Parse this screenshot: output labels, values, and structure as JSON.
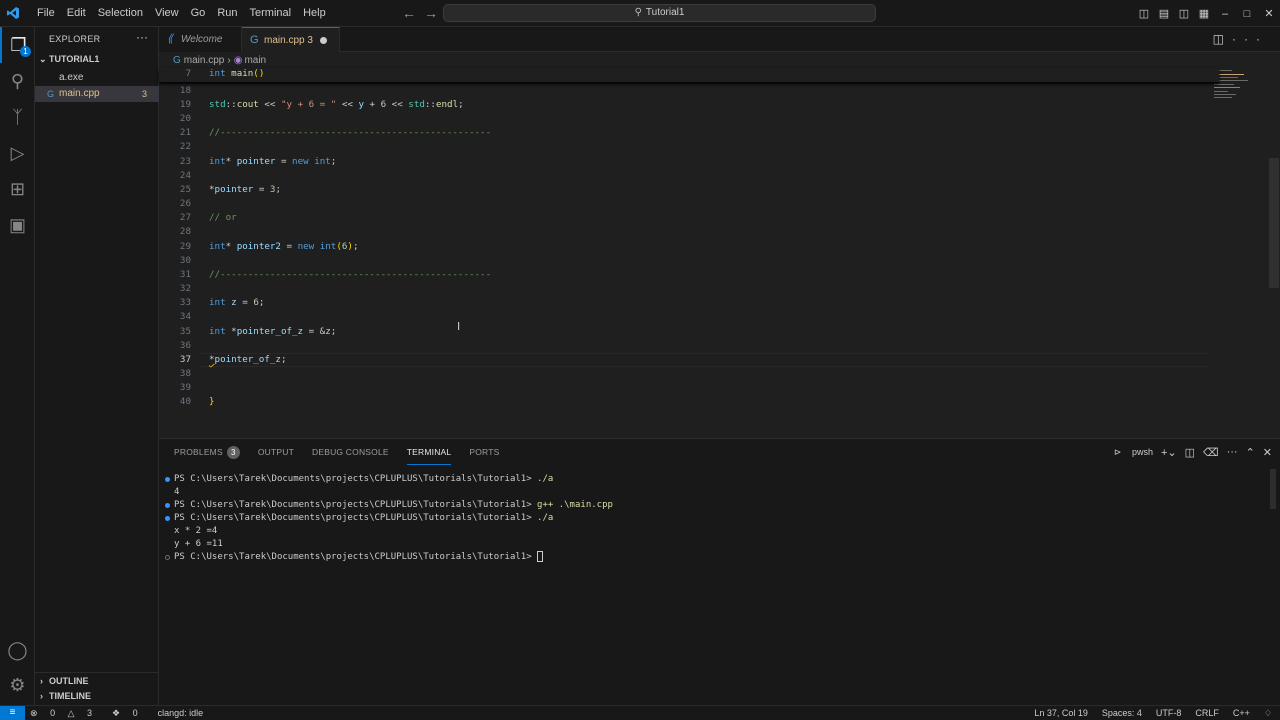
{
  "window": {
    "title": "Tutorial1"
  },
  "menu": [
    "File",
    "Edit",
    "Selection",
    "View",
    "Go",
    "Run",
    "Terminal",
    "Help"
  ],
  "explorer": {
    "title": "EXPLORER",
    "folder": "TUTORIAL1",
    "files": [
      {
        "name": "a.exe"
      },
      {
        "name": "main.cpp",
        "badge": "3"
      }
    ],
    "sections": [
      "OUTLINE",
      "TIMELINE"
    ]
  },
  "activity_badge": "1",
  "tabs": [
    {
      "label": "Welcome"
    },
    {
      "label": "main.cpp 3"
    }
  ],
  "breadcrumb": {
    "file": "main.cpp",
    "symbol": "main"
  },
  "editor": {
    "sticky": {
      "line": "7",
      "text": "int main()"
    },
    "current_line": "37"
  },
  "panel": {
    "tabs": [
      "PROBLEMS",
      "OUTPUT",
      "DEBUG CONSOLE",
      "TERMINAL",
      "PORTS"
    ],
    "problems_count": "3",
    "shell": "pwsh",
    "terminal_lines": [
      {
        "prompt": "PS C:\\Users\\Tarek\\Documents\\projects\\CPLUPLUS\\Tutorials\\Tutorial1> ",
        "cmd": "./a"
      },
      {
        "prompt": "4",
        "cmd": ""
      },
      {
        "prompt": "PS C:\\Users\\Tarek\\Documents\\projects\\CPLUPLUS\\Tutorials\\Tutorial1> ",
        "cmd": "g++ .\\main.cpp"
      },
      {
        "prompt": "PS C:\\Users\\Tarek\\Documents\\projects\\CPLUPLUS\\Tutorials\\Tutorial1> ",
        "cmd": "./a"
      },
      {
        "prompt": "x * 2 =4",
        "cmd": ""
      },
      {
        "prompt": "y + 6 =11",
        "cmd": ""
      },
      {
        "prompt": "PS C:\\Users\\Tarek\\Documents\\projects\\CPLUPLUS\\Tutorials\\Tutorial1> ",
        "cmd": ""
      }
    ]
  },
  "status": {
    "errors": "0",
    "warnings": "3",
    "ports": "0",
    "clangd": "clangd: idle",
    "position": "Ln 37, Col 19",
    "spaces": "Spaces: 4",
    "encoding": "UTF-8",
    "eol": "CRLF",
    "language": "C++"
  },
  "colors": {
    "accent": "#0078d4",
    "modified": "#e2c08d"
  }
}
